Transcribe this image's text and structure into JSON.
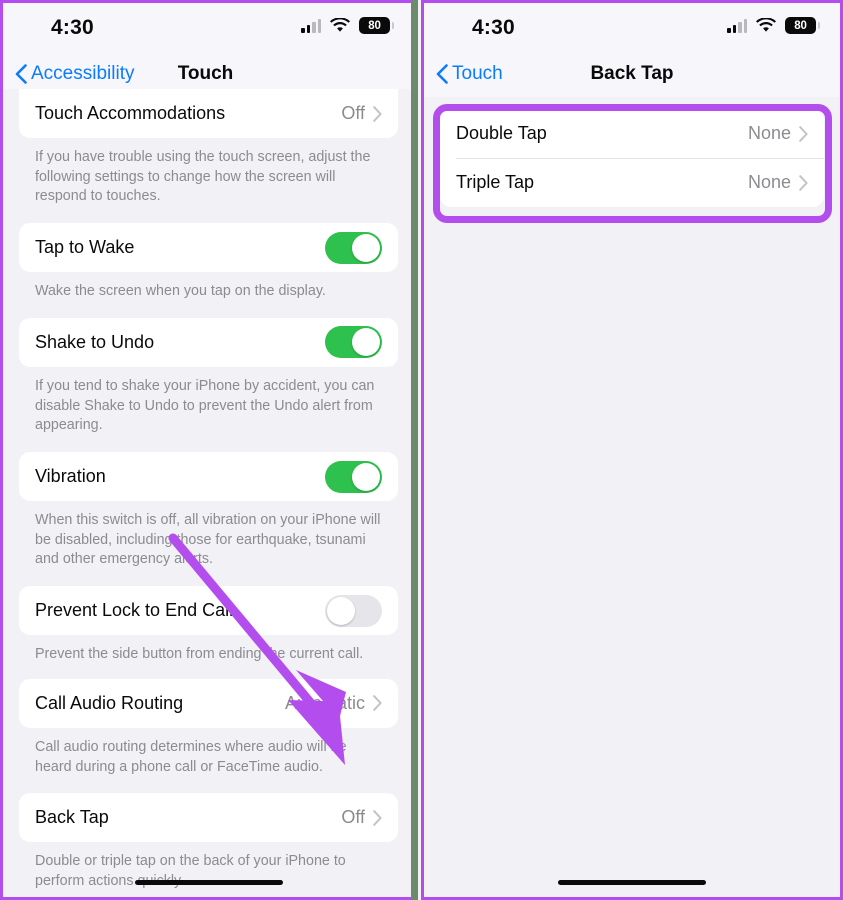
{
  "left_phone": {
    "status_bar": {
      "time": "4:30",
      "cellular_icon": "cellular-bars-icon",
      "wifi_icon": "wifi-icon",
      "battery_percent": "80"
    },
    "nav": {
      "back_label": "Accessibility",
      "back_icon": "chevron-left-icon",
      "title": "Touch"
    },
    "sections": [
      {
        "rows": [
          {
            "label": "Touch Accommodations",
            "value": "Off",
            "type": "disclosure"
          }
        ],
        "footnote": "If you have trouble using the touch screen, adjust the following settings to change how the screen will respond to touches."
      },
      {
        "rows": [
          {
            "label": "Tap to Wake",
            "value": "on",
            "type": "toggle"
          }
        ],
        "footnote": "Wake the screen when you tap on the display."
      },
      {
        "rows": [
          {
            "label": "Shake to Undo",
            "value": "on",
            "type": "toggle"
          }
        ],
        "footnote": "If you tend to shake your iPhone by accident, you can disable Shake to Undo to prevent the Undo alert from appearing."
      },
      {
        "rows": [
          {
            "label": "Vibration",
            "value": "on",
            "type": "toggle"
          }
        ],
        "footnote": "When this switch is off, all vibration on your iPhone will be disabled, including those for earthquake, tsunami and other emergency alerts."
      },
      {
        "rows": [
          {
            "label": "Prevent Lock to End Call",
            "value": "off",
            "type": "toggle"
          }
        ],
        "footnote": "Prevent the side button from ending the current call."
      },
      {
        "rows": [
          {
            "label": "Call Audio Routing",
            "value": "Automatic",
            "type": "disclosure"
          }
        ],
        "footnote": "Call audio routing determines where audio will be heard during a phone call or FaceTime audio."
      },
      {
        "rows": [
          {
            "label": "Back Tap",
            "value": "Off",
            "type": "disclosure"
          }
        ],
        "footnote": "Double or triple tap on the back of your iPhone to perform actions quickly."
      }
    ]
  },
  "right_phone": {
    "status_bar": {
      "time": "4:30",
      "cellular_icon": "cellular-bars-icon",
      "wifi_icon": "wifi-icon",
      "battery_percent": "80"
    },
    "nav": {
      "back_label": "Touch",
      "back_icon": "chevron-left-icon",
      "title": "Back Tap"
    },
    "sections": [
      {
        "rows": [
          {
            "label": "Double Tap",
            "value": "None",
            "type": "disclosure"
          },
          {
            "label": "Triple Tap",
            "value": "None",
            "type": "disclosure"
          }
        ],
        "footnote": ""
      }
    ]
  },
  "annotations": {
    "color": "#b44dee",
    "arrow_icon": "pointer-arrow-icon",
    "highlight_icon": "highlight-rectangle-icon"
  },
  "colors": {
    "accent_blue": "#0a7cff",
    "toggle_on": "#2fc14d",
    "toggle_off": "#e6e5ea",
    "annotation_purple": "#b44dee",
    "page_background": "#f2f1f6",
    "card_background": "#ffffff",
    "secondary_text": "#8b8b90"
  }
}
